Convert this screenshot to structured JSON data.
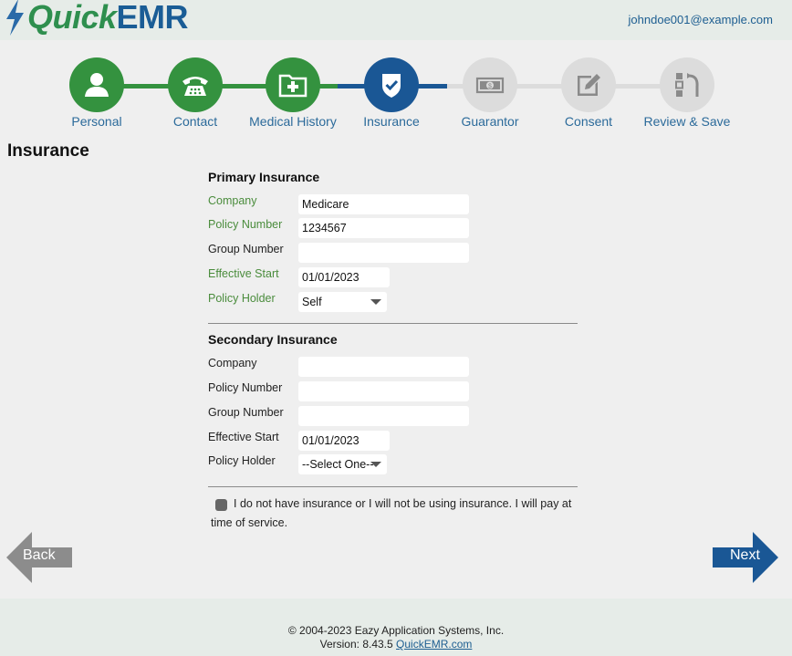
{
  "header": {
    "logo_quick": "Quick",
    "logo_emr": "EMR",
    "user_email": "johndoe001@example.com"
  },
  "steps": [
    {
      "label": "Personal",
      "icon": "person-icon",
      "state": "done"
    },
    {
      "label": "Contact",
      "icon": "phone-icon",
      "state": "done"
    },
    {
      "label": "Medical History",
      "icon": "medical-folder-icon",
      "state": "done"
    },
    {
      "label": "Insurance",
      "icon": "shield-check-icon",
      "state": "current"
    },
    {
      "label": "Guarantor",
      "icon": "money-icon",
      "state": "pending"
    },
    {
      "label": "Consent",
      "icon": "pencil-edit-icon",
      "state": "pending"
    },
    {
      "label": "Review & Save",
      "icon": "review-icon",
      "state": "pending"
    }
  ],
  "colors": {
    "done": "#34923f",
    "current": "#1a5795",
    "pending": "#dcdcdc",
    "required_label": "#4a8c3c",
    "link": "#1d5e91"
  },
  "page": {
    "title": "Insurance"
  },
  "primary": {
    "title": "Primary Insurance",
    "company_label": "Company",
    "company_value": "Medicare",
    "policy_label": "Policy Number",
    "policy_value": "1234567",
    "group_label": "Group Number",
    "group_value": "",
    "start_label": "Effective Start",
    "start_value": "01/01/2023",
    "holder_label": "Policy Holder",
    "holder_value": "Self"
  },
  "secondary": {
    "title": "Secondary Insurance",
    "company_label": "Company",
    "company_value": "",
    "policy_label": "Policy Number",
    "policy_value": "",
    "group_label": "Group Number",
    "group_value": "",
    "start_label": "Effective Start",
    "start_value": "01/01/2023",
    "holder_label": "Policy Holder",
    "holder_value": "--Select One--"
  },
  "no_insurance": {
    "text": "I do not have insurance or I will not be using insurance. I will pay at time of service.",
    "checked": false
  },
  "nav": {
    "back": "Back",
    "next": "Next"
  },
  "footer": {
    "copyright": "© 2004-2023 Eazy Application Systems, Inc.",
    "version_prefix": "Version: 8.43.5",
    "link_text": "QuickEMR.com"
  }
}
